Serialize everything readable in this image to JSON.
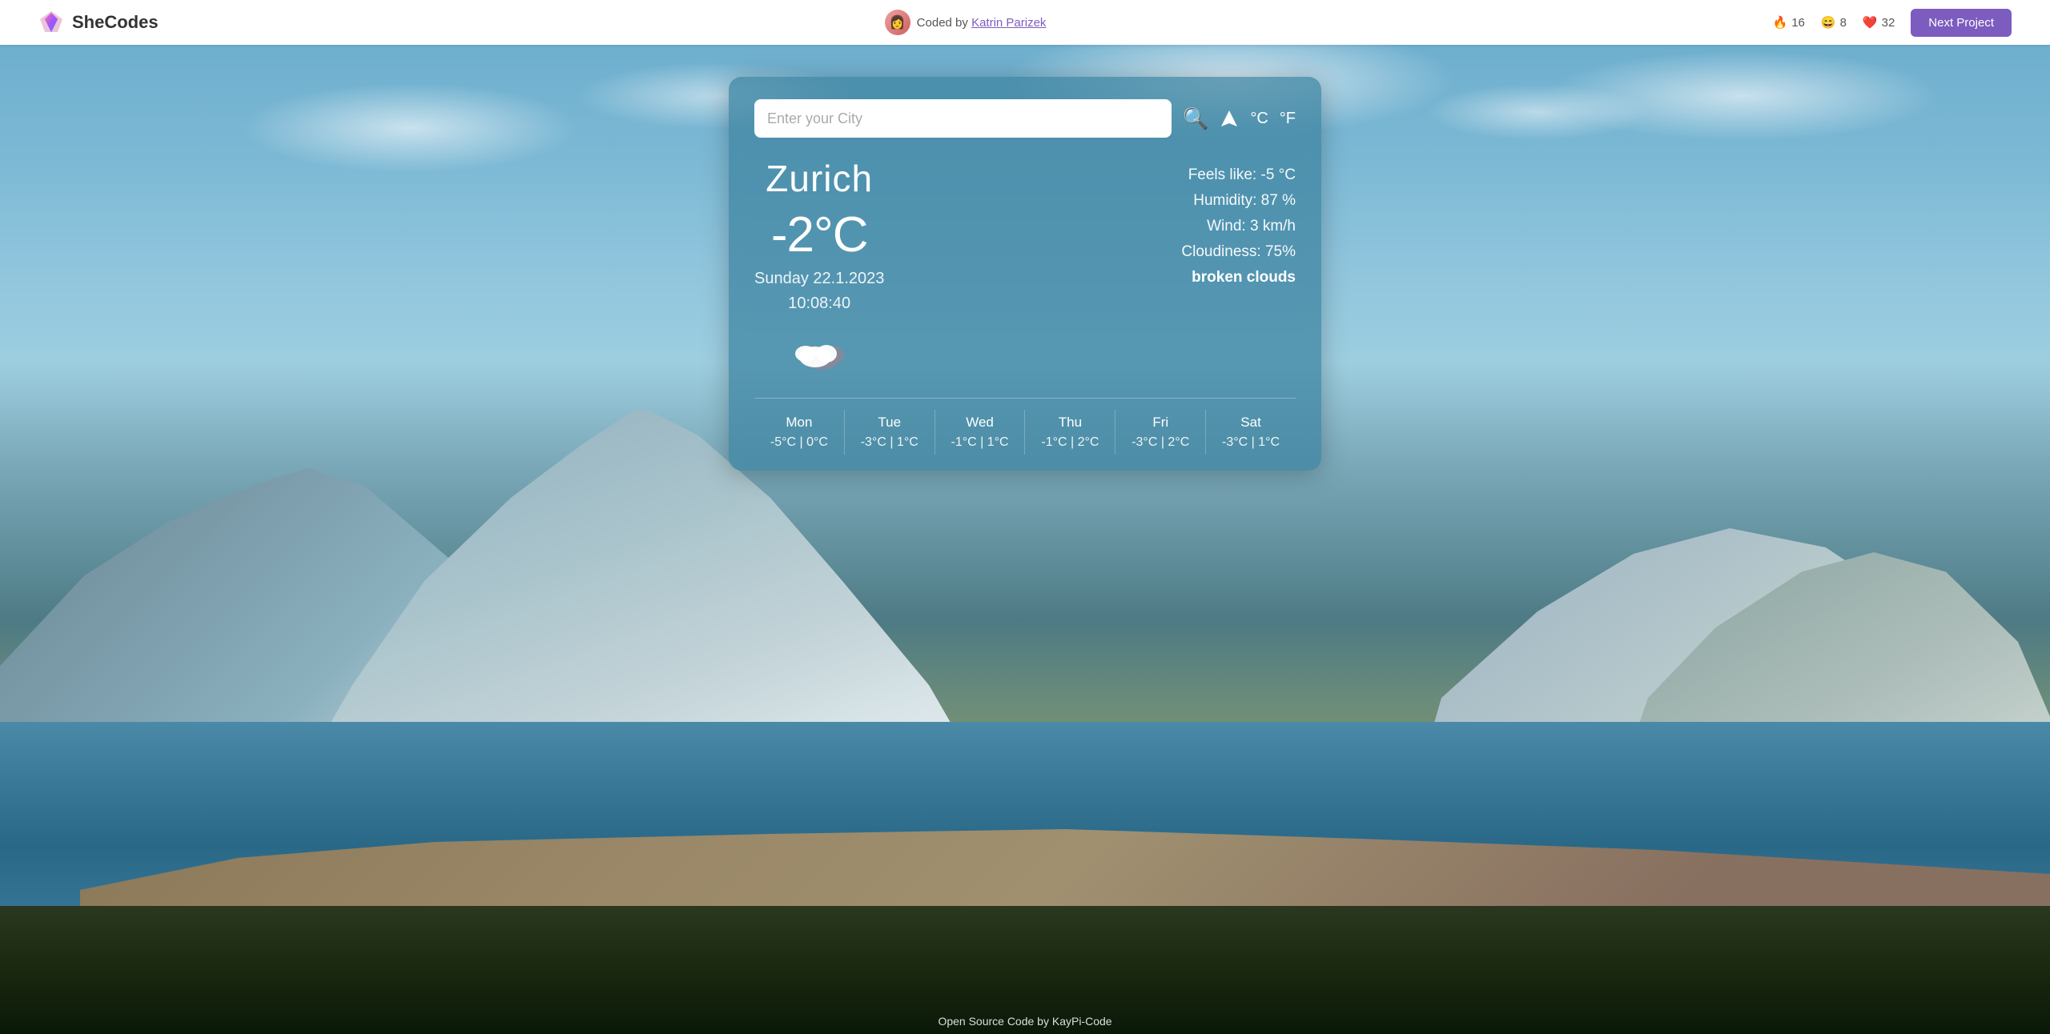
{
  "navbar": {
    "logo_text": "SheCodes",
    "coded_by_text": "Coded by",
    "author_name": "Katrin Parizek",
    "reactions": {
      "fire_count": "16",
      "laugh_count": "8",
      "heart_count": "32"
    },
    "next_project_label": "Next Project"
  },
  "search": {
    "placeholder": "Enter your City"
  },
  "units": {
    "celsius_label": "°C",
    "fahrenheit_label": "°F"
  },
  "weather": {
    "city": "Zurich",
    "temperature": "-2°C",
    "date": "Sunday 22.1.2023",
    "time": "10:08:40",
    "feels_like": "Feels like: -5 °C",
    "humidity": "Humidity: 87 %",
    "wind": "Wind: 3 km/h",
    "cloudiness": "Cloudiness: 75%",
    "description": "broken clouds",
    "icon": "☁️"
  },
  "forecast": [
    {
      "day": "Mon",
      "temps": "-5°C | 0°C"
    },
    {
      "day": "Tue",
      "temps": "-3°C | 1°C"
    },
    {
      "day": "Wed",
      "temps": "-1°C | 1°C"
    },
    {
      "day": "Thu",
      "temps": "-1°C | 2°C"
    },
    {
      "day": "Fri",
      "temps": "-3°C | 2°C"
    },
    {
      "day": "Sat",
      "temps": "-3°C | 1°C"
    }
  ],
  "footer": {
    "text": "Open Source Code by KayPi-Code"
  },
  "icons": {
    "search": "🔍",
    "location": "➤",
    "fire": "🔥",
    "laugh": "😄",
    "heart": "❤️"
  }
}
